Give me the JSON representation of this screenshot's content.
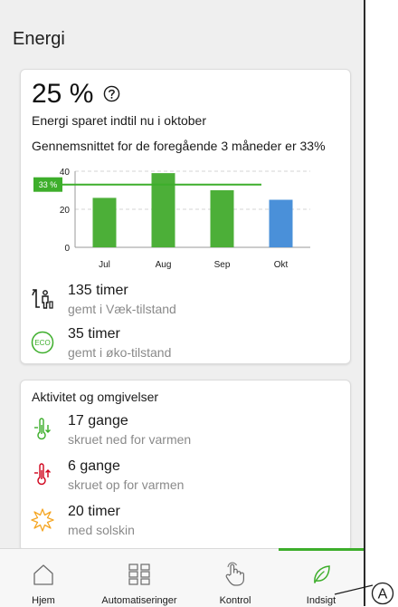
{
  "header": {
    "title": "Energi"
  },
  "summary": {
    "percent": "25 %",
    "saved_label": "Energi sparet indtil nu i oktober",
    "average_label": "Gennemsnittet for de foregående 3 måneder er 33%"
  },
  "chart_data": {
    "type": "bar",
    "categories": [
      "Jul",
      "Aug",
      "Sep",
      "Okt"
    ],
    "values": [
      26,
      39,
      30,
      25
    ],
    "colors": [
      "#4caf38",
      "#4caf38",
      "#4caf38",
      "#4a90d9"
    ],
    "ylim": [
      0,
      40
    ],
    "yticks": [
      "0",
      "20",
      "40"
    ],
    "reference": {
      "value": 33,
      "label": "33 %",
      "color": "#3dae2b"
    },
    "grid": true
  },
  "stats": [
    {
      "value": "135 timer",
      "desc": "gemt i Væk-tilstand",
      "icon": "away-mode-icon"
    },
    {
      "value": "35 timer",
      "desc": "gemt i øko-tilstand",
      "icon": "eco-mode-icon"
    }
  ],
  "activity": {
    "title": "Aktivitet og omgivelser",
    "items": [
      {
        "value": "17 gange",
        "desc": "skruet ned for varmen",
        "icon": "thermometer-down-icon",
        "color": "#3dae2b"
      },
      {
        "value": "6 gange",
        "desc": "skruet op for varmen",
        "icon": "thermometer-up-icon",
        "color": "#d0021b"
      },
      {
        "value": "20 timer",
        "desc": "med solskin",
        "icon": "sun-icon",
        "color": "#f5a623"
      }
    ]
  },
  "nav": {
    "items": [
      {
        "label": "Hjem",
        "icon": "home-icon"
      },
      {
        "label": "Automatiseringer",
        "icon": "automations-grid-icon"
      },
      {
        "label": "Kontrol",
        "icon": "touch-hand-icon"
      },
      {
        "label": "Indsigt",
        "icon": "leaf-icon"
      }
    ],
    "active": "Indsigt",
    "accent": "#3dae2b"
  },
  "callout": {
    "label": "A"
  }
}
